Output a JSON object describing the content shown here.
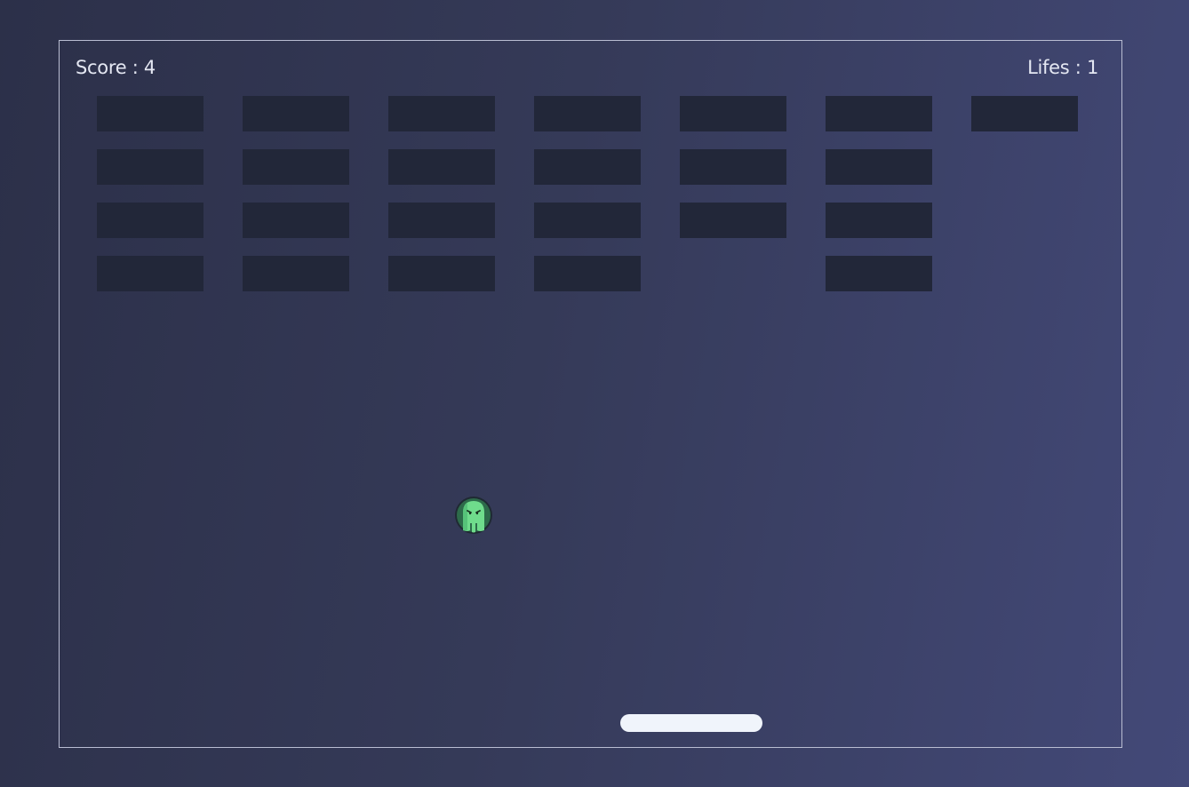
{
  "hud": {
    "score_text": "Score : 4",
    "lives_text": "Lifes : 1"
  },
  "bricks": [
    [
      true,
      true,
      true,
      true,
      true,
      true,
      true
    ],
    [
      true,
      true,
      true,
      true,
      true,
      true,
      false
    ],
    [
      true,
      true,
      true,
      true,
      true,
      true,
      false
    ],
    [
      true,
      true,
      true,
      true,
      false,
      true,
      false
    ]
  ],
  "ball": {
    "icon": "green-octopus-icon"
  },
  "colors": {
    "brick": "#222739",
    "paddle": "#f0f4fb",
    "frame_border": "#b9bdd2",
    "hud_text": "#e4e7f2",
    "ball_body": "#6fdc8c",
    "ball_bg": "#1f2a33"
  }
}
